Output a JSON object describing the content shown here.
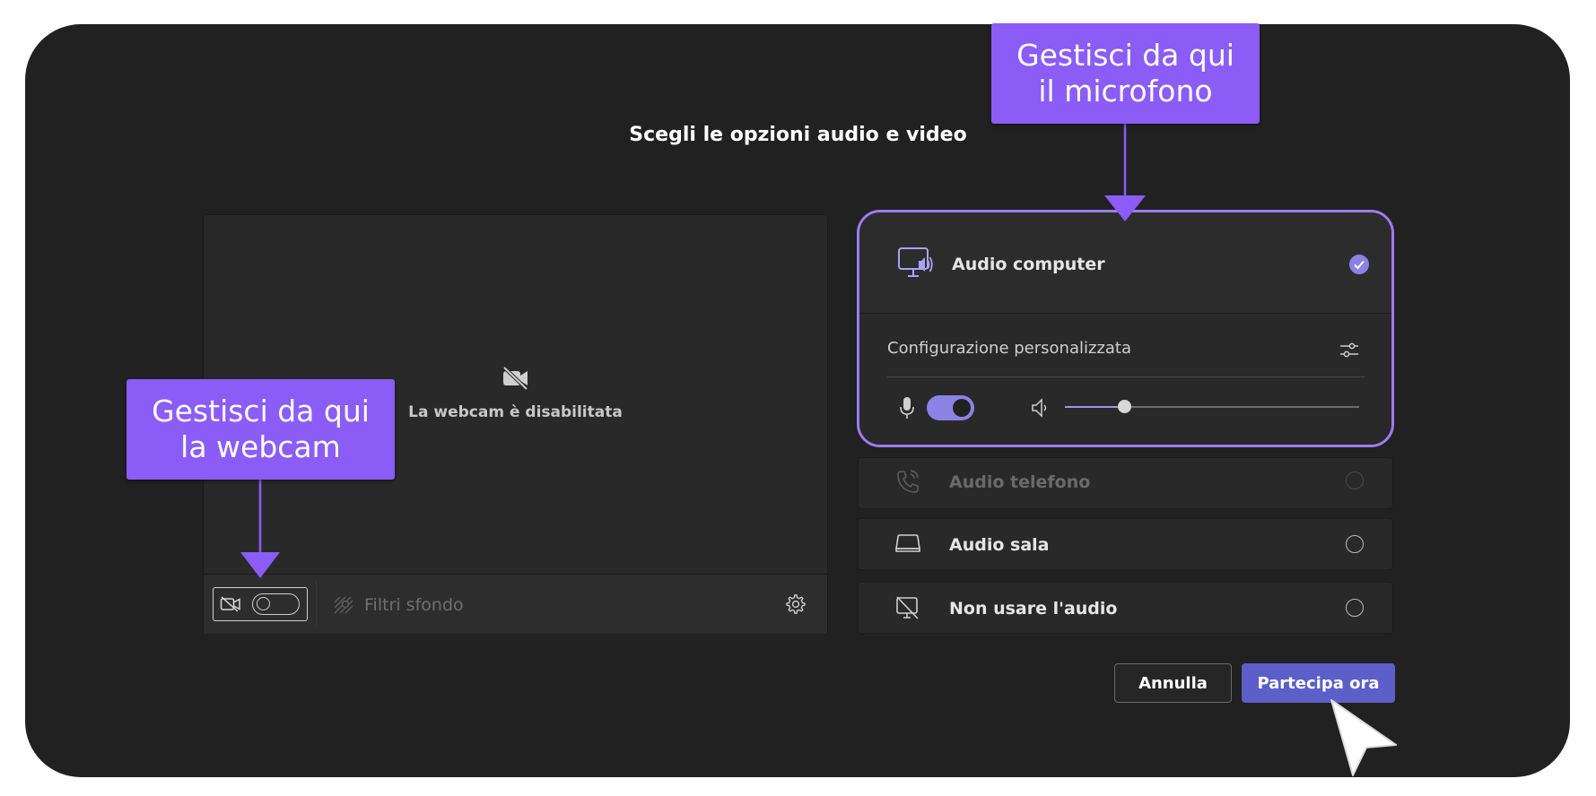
{
  "dialog": {
    "title": "Scegli le opzioni audio e video"
  },
  "preview": {
    "camera_off_text": "La webcam è disabilitata",
    "camera_toggle_on": false,
    "background_filters_label": "Filtri sfondo",
    "icons": {
      "camera_off": "video-off-icon",
      "background_filters": "background-effects-icon",
      "settings": "gear-icon"
    }
  },
  "audio_options": {
    "selected": {
      "label": "Audio computer",
      "icon": "computer-audio-icon",
      "checked": true,
      "config_label": "Configurazione personalizzata",
      "mic_toggle_on": true,
      "speaker_volume": 0.2
    },
    "items": [
      {
        "label": "Audio telefono",
        "icon": "phone-audio-icon",
        "disabled": true
      },
      {
        "label": "Audio sala",
        "icon": "room-audio-icon",
        "disabled": false
      },
      {
        "label": "Non usare l'audio",
        "icon": "no-audio-icon",
        "disabled": false
      }
    ]
  },
  "buttons": {
    "cancel_label": "Annulla",
    "join_label": "Partecipa ora"
  },
  "callouts": {
    "microphone": [
      "Gestisci da qui",
      "il microfono"
    ],
    "webcam": [
      "Gestisci da qui",
      "la webcam"
    ]
  },
  "colors": {
    "accent_callout": "#8b5cf6",
    "selected_border": "#9d7bf5",
    "join_button": "#5b5fc7",
    "toggle_on": "#8b82e6",
    "check": "#8b82e6"
  }
}
